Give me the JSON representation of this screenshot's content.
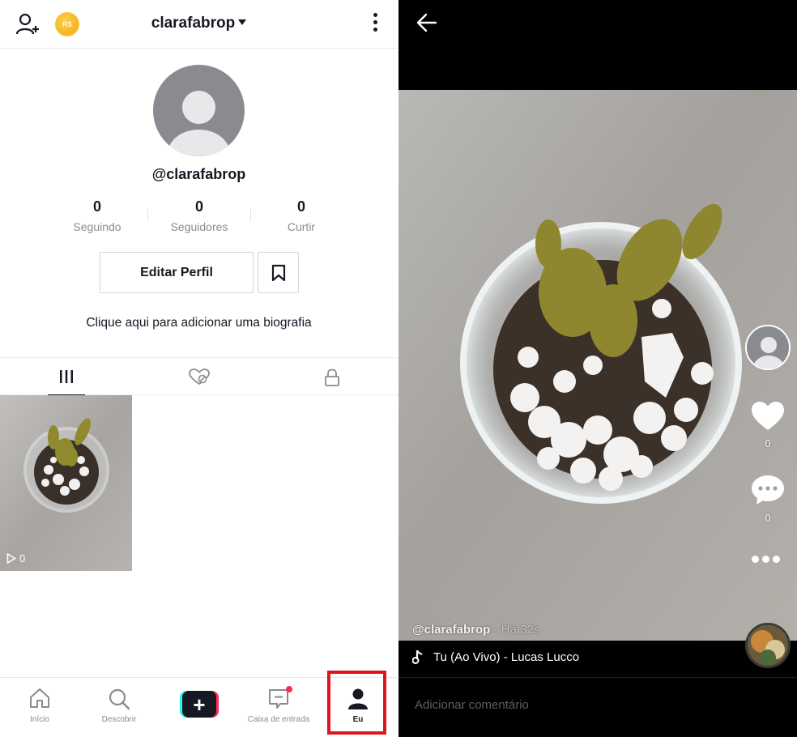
{
  "profile": {
    "username_top": "clarafabrop",
    "handle": "@clarafabrop",
    "coin_label": "R$",
    "stats": [
      {
        "value": "0",
        "label": "Seguindo"
      },
      {
        "value": "0",
        "label": "Seguidores"
      },
      {
        "value": "0",
        "label": "Curtir"
      }
    ],
    "edit_button": "Editar Perfil",
    "bio_prompt": "Clique aqui para adicionar uma biografia",
    "video_views": "0"
  },
  "bottom_nav": [
    {
      "label": "Início",
      "icon": "home-icon"
    },
    {
      "label": "Descobrir",
      "icon": "search-icon"
    },
    {
      "label": "",
      "icon": "plus-icon"
    },
    {
      "label": "Caixa de entrada",
      "icon": "inbox-icon"
    },
    {
      "label": "Eu",
      "icon": "person-icon"
    }
  ],
  "video": {
    "likes": "0",
    "comments": "0",
    "author": "@clarafabrop",
    "time": " · Há 32s",
    "music": "Tu (Ao Vivo) - Lucas Lucco",
    "comment_placeholder": "Adicionar comentário"
  },
  "colors": {
    "text": "#161823",
    "secondary": "#8a8b91",
    "accent_red": "#fe2c55",
    "accent_cyan": "#25f4ee",
    "highlight": "#e0141e"
  }
}
